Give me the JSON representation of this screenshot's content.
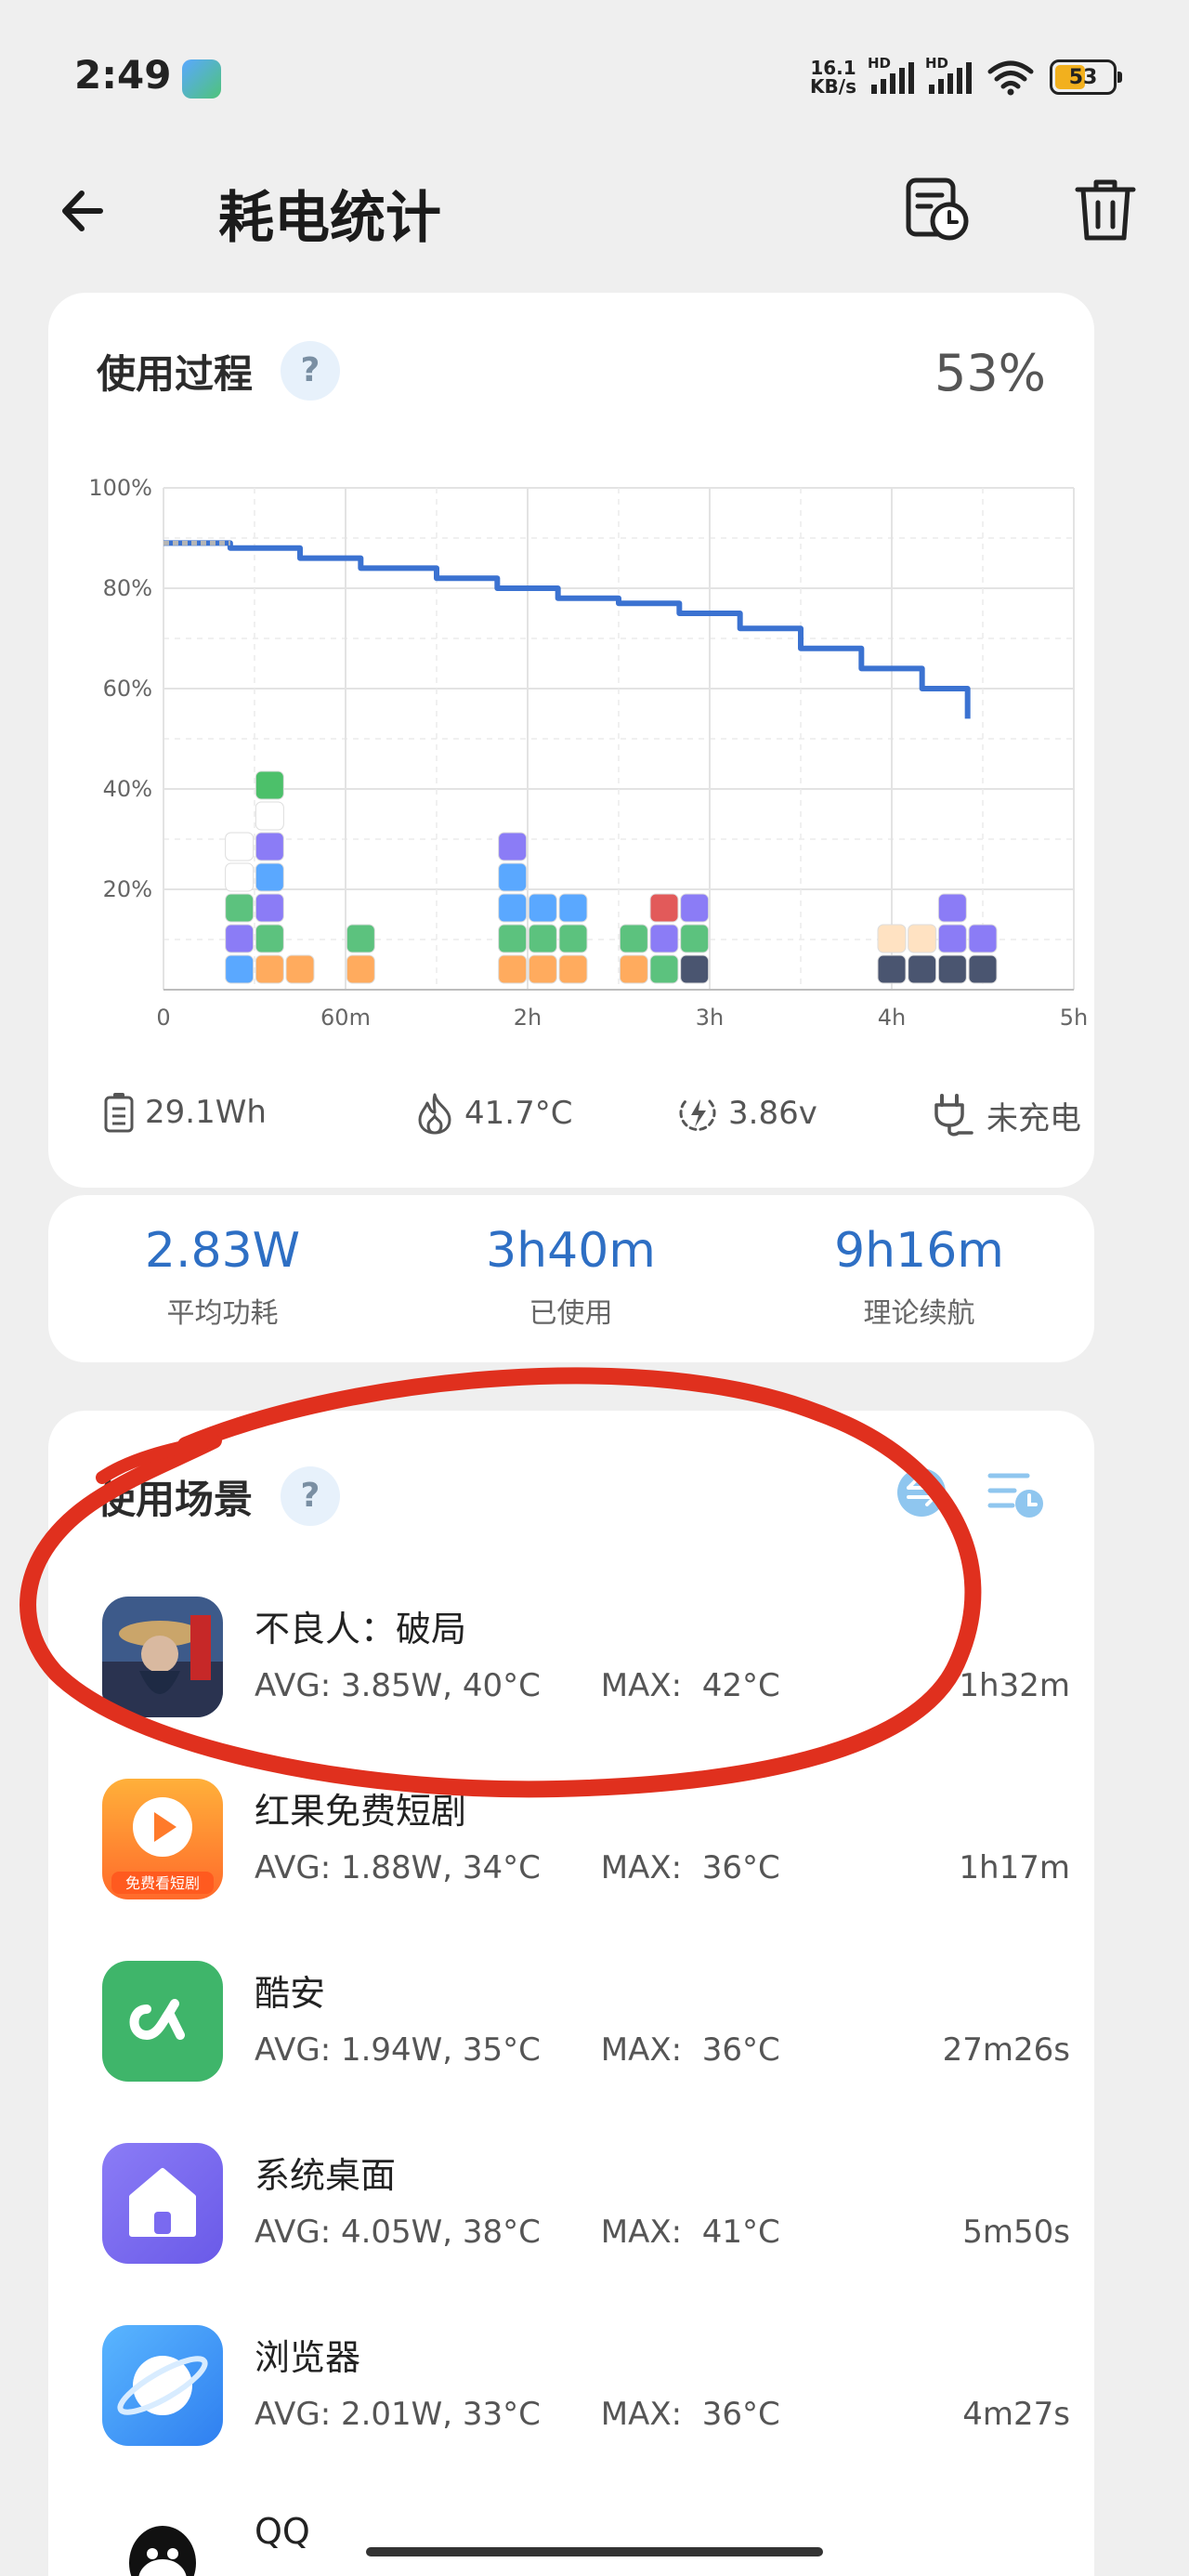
{
  "status_bar": {
    "time": "2:49",
    "net_speed_value": "16.1",
    "net_speed_unit": "KB/s",
    "signal_1": "HD",
    "signal_2": "HD",
    "battery_level": "53",
    "battery_fraction": 0.53
  },
  "header": {
    "title": "耗电统计",
    "icons": [
      "back-arrow-icon",
      "history-icon",
      "delete-icon"
    ]
  },
  "usage_card": {
    "title": "使用过程",
    "help": "?",
    "percent": "53%",
    "info": {
      "capacity": "29.1Wh",
      "temperature": "41.7°C",
      "voltage": "3.86v",
      "charging": "未充电"
    }
  },
  "chart_data": {
    "type": "line",
    "y_ticks": [
      "100%",
      "80%",
      "60%",
      "40%",
      "20%"
    ],
    "x_ticks": [
      "0",
      "60m",
      "2h",
      "3h",
      "4h",
      "5h"
    ],
    "xlim_minutes": [
      0,
      300
    ],
    "ylim_percent": [
      0,
      100
    ],
    "grid": true,
    "series": [
      {
        "x_minutes": [
          0,
          22,
          45,
          65,
          90,
          110,
          130,
          150,
          170,
          190,
          210,
          230,
          250,
          265
        ],
        "y_percent": [
          89,
          88,
          86,
          84,
          82,
          80,
          78,
          77,
          75,
          72,
          68,
          64,
          60,
          54
        ]
      }
    ],
    "app_stacks": [
      {
        "x_minutes": 25,
        "apps": [
          "browser",
          "home",
          "coolapk",
          "qq",
          "pinduoduo"
        ]
      },
      {
        "x_minutes": 35,
        "apps": [
          "video",
          "coolapk",
          "home",
          "browser",
          "home",
          "settings",
          "wechat"
        ]
      },
      {
        "x_minutes": 45,
        "apps": [
          "video"
        ]
      },
      {
        "x_minutes": 65,
        "apps": [
          "video",
          "coolapk"
        ]
      },
      {
        "x_minutes": 115,
        "apps": [
          "video",
          "coolapk",
          "browser",
          "browser",
          "home"
        ]
      },
      {
        "x_minutes": 125,
        "apps": [
          "video",
          "coolapk",
          "browser"
        ]
      },
      {
        "x_minutes": 135,
        "apps": [
          "video",
          "coolapk",
          "browser"
        ]
      },
      {
        "x_minutes": 155,
        "apps": [
          "video",
          "coolapk"
        ]
      },
      {
        "x_minutes": 165,
        "apps": [
          "coolapk",
          "home",
          "red"
        ]
      },
      {
        "x_minutes": 175,
        "apps": [
          "game",
          "coolapk",
          "home"
        ]
      },
      {
        "x_minutes": 240,
        "apps": [
          "game",
          "cup"
        ]
      },
      {
        "x_minutes": 250,
        "apps": [
          "game",
          "cup"
        ]
      },
      {
        "x_minutes": 260,
        "apps": [
          "game",
          "home",
          "home"
        ]
      },
      {
        "x_minutes": 270,
        "apps": [
          "game",
          "home"
        ]
      }
    ]
  },
  "summary": {
    "avg_power": {
      "value": "2.83W",
      "label": "平均功耗"
    },
    "used": {
      "value": "3h40m",
      "label": "已使用"
    },
    "estimate": {
      "value": "9h16m",
      "label": "理论续航"
    }
  },
  "scenes_card": {
    "title": "使用场景",
    "help": "?",
    "apps": [
      {
        "name": "不良人：破局",
        "avg": "AVG: 3.85W, 40°C",
        "max": "MAX:  42°C",
        "duration": "1h32m",
        "icon": "game-icon"
      },
      {
        "name": "红果免费短剧",
        "avg": "AVG: 1.88W, 34°C",
        "max": "MAX:  36°C",
        "duration": "1h17m",
        "icon": "video-icon",
        "icon_caption": "免费看短剧"
      },
      {
        "name": "酷安",
        "avg": "AVG: 1.94W, 35°C",
        "max": "MAX:  36°C",
        "duration": "27m26s",
        "icon": "coolapk-icon"
      },
      {
        "name": "系统桌面",
        "avg": "AVG: 4.05W, 38°C",
        "max": "MAX:  41°C",
        "duration": "5m50s",
        "icon": "home-icon"
      },
      {
        "name": "浏览器",
        "avg": "AVG: 2.01W, 33°C",
        "max": "MAX:  36°C",
        "duration": "4m27s",
        "icon": "browser-icon"
      },
      {
        "name": "QQ",
        "avg": "",
        "max": "",
        "duration": "",
        "icon": "qq-icon"
      }
    ]
  },
  "colors": {
    "accent_blue": "#2e6fc4",
    "line_blue": "#3b72d1",
    "annotation_red": "#e0301e",
    "battery_yellow": "#f2b01e"
  }
}
